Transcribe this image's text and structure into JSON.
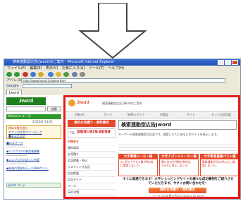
{
  "browser": {
    "title": "検索連動型広告(Jword)のご案内 - Microsoft Internet Explorer",
    "menu": [
      "ファイル(F)",
      "編集(E)",
      "表示(V)",
      "お気に入り(A)",
      "ツール(T)",
      "ヘルプ(H)"
    ],
    "address_label": "アドレス(D)",
    "address": "http://www.jword.jp/advertise/",
    "google_label": "Google",
    "tab_label": "Jword"
  },
  "left_page": {
    "logo_text": "Jword",
    "search_button": "検索",
    "news_header": "Yahoo!ニュース",
    "date_text": "5月16日 14:31",
    "section_title": "JWord株式会社",
    "links": [
      "ヤフーが北京オリンピック",
      "■エコブログ",
      "■ロゴマーク",
      "◆エコブログの参加者募集",
      "◆エコブログの詳しい内容",
      "◆新規の登録を行ったWebサイト"
    ],
    "footer_link": "Jword ページ"
  },
  "site": {
    "logo": "Jword",
    "tagline": "検索連動型広告 JWordのご案内",
    "nav": [
      "JWord",
      "ガイド",
      "SEMメディア",
      "代理店",
      "サイト",
      "ネット広告用語"
    ],
    "banner_title": "検索連動型広告Jword",
    "side_banner": "無料お見積り・資料請求",
    "phone_label": "TEL",
    "phone": "0800-919-6059",
    "side_sub": "お問合せ",
    "side_links": [
      "資料請求",
      "お見積り",
      "広告掲載・申込",
      "リスティング広告",
      "広告掲載",
      "広告ガイド",
      "メール",
      "SEO対策"
    ],
    "intro": "キーワード検索連動型の広告です。検索した人にあなたのサイトを表示します。",
    "boxes": [
      {
        "title": "大手事業メーカー様",
        "body": "2ヶ月でアクセス数が約3倍に増加しました。"
      },
      {
        "title": "大手アパレルメーカー様",
        "body": "問い合わせ件数が前年比150%に向上しました。"
      },
      {
        "title": "大手教育産業ベスト様",
        "body": "資料請求が月40件以上に増加しました。"
      }
    ],
    "cta_text": "すぐに実感できます！大手ショッピングサイトの様々な成功事例をご紹介させていただきます。今すぐお問い合わせを！",
    "cta_button": "無料お見積り・資料請求",
    "footer": "メールでのお問い合わせ 0800-919-6059"
  },
  "colors": {
    "highlight_border": "#e41b1b",
    "header_green": "#2f9a2c",
    "accent_orange": "#e4492a",
    "titlebar_blue": "#1f4fb8"
  }
}
